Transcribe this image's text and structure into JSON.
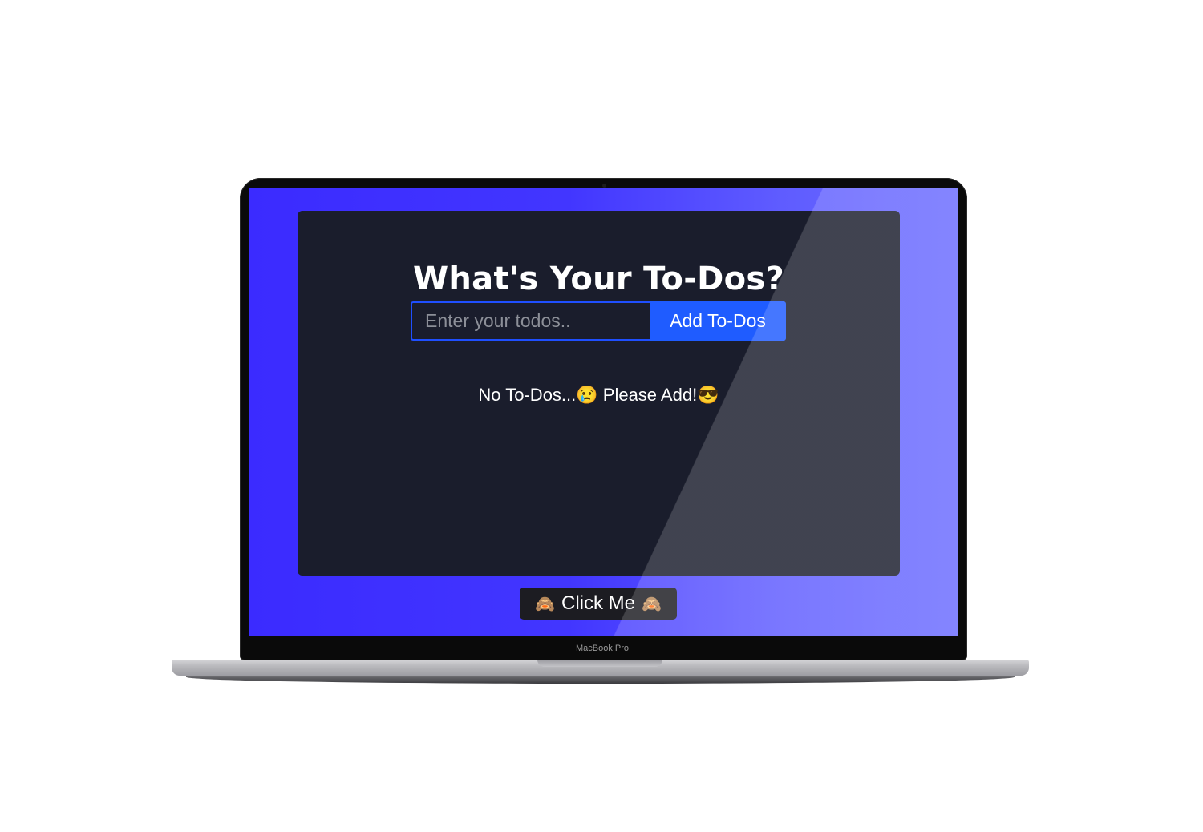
{
  "app": {
    "title": "What's Your To-Dos?",
    "input_placeholder": "Enter your todos..",
    "add_button_label": "Add To-Dos",
    "empty_message": "No To-Dos...😢 Please Add!😎",
    "click_me_label": "Click Me",
    "click_me_icon": "🙈"
  },
  "device": {
    "bezel_label": "MacBook Pro"
  },
  "colors": {
    "screen_background_start": "#3b2bff",
    "screen_background_end": "#6b6cff",
    "card_background": "#1a1d2c",
    "accent_blue": "#1f5cff"
  }
}
